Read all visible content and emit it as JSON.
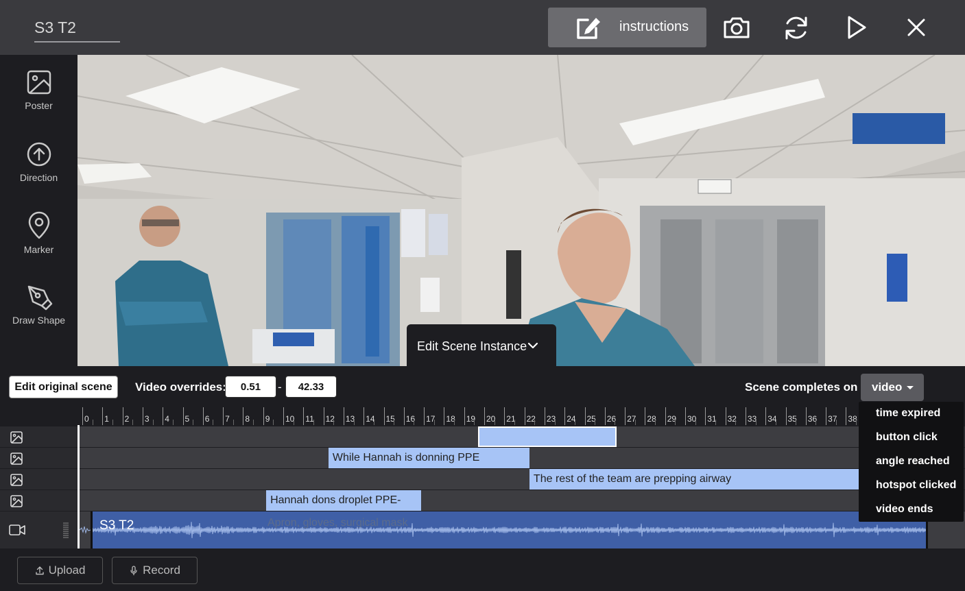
{
  "header": {
    "scene_title": "S3 T2",
    "instructions_label": "instructions"
  },
  "icons": {
    "instructions": "edit-icon",
    "screenshot": "camera-icon",
    "reset": "refresh-icon",
    "play": "play-icon",
    "close": "close-icon"
  },
  "tools": [
    {
      "label": "Poster",
      "icon": "image-icon"
    },
    {
      "label": "Direction",
      "icon": "arrow-up-circle-icon"
    },
    {
      "label": "Marker",
      "icon": "map-pin-icon"
    },
    {
      "label": "Draw Shape",
      "icon": "pen-tool-icon"
    }
  ],
  "edit_scene_instance": "Edit Scene Instance",
  "controls": {
    "edit_original_label": "Edit original scene",
    "video_overrides_label": "Video overrides:",
    "override_start": "0.51",
    "override_separator": "-",
    "override_end": "42.33",
    "completes_on_label": "Scene completes on",
    "completes_on_value": "video"
  },
  "completes_on_options": [
    "time expired",
    "button click",
    "angle reached",
    "hotspot clicked",
    "video ends"
  ],
  "timeline": {
    "ticks": [
      "0",
      "1",
      "2",
      "3",
      "4",
      "5",
      "6",
      "7",
      "8",
      "9",
      "10",
      "11",
      "12",
      "13",
      "14",
      "15",
      "16",
      "17",
      "18",
      "19",
      "20",
      "21",
      "22",
      "23",
      "24",
      "25",
      "26",
      "27",
      "28",
      "29",
      "30",
      "31",
      "32",
      "33",
      "34",
      "35",
      "36",
      "37",
      "38"
    ],
    "tracks": [
      {
        "icon": "image-icon",
        "clip_text": "",
        "start": 19.7,
        "end": 26.6
      },
      {
        "icon": "image-icon",
        "clip_text": "While Hannah is donning PPE",
        "start": 12.25,
        "end": 22.25
      },
      {
        "icon": "image-icon",
        "clip_text": "The rest of the team are prepping airway",
        "start": 22.25,
        "end": 38.7
      },
      {
        "icon": "image-icon",
        "clip_text": "Hannah dons droplet PPE-",
        "start": 9.15,
        "end": 16.85
      }
    ],
    "video_track": {
      "icon": "video-icon",
      "clip_label": "S3 T2",
      "ghost_text": "Apron, gloves, surgical mask"
    }
  },
  "bottom": {
    "upload_label": "Upload",
    "record_label": "Record",
    "upload_icon": "upload-icon",
    "record_icon": "microphone-icon"
  },
  "colors": {
    "topbar": "#3a3a3e",
    "clip": "#a7c4f6",
    "video_clip": "#3f5fa6",
    "track_lane": "#3d3d41"
  }
}
